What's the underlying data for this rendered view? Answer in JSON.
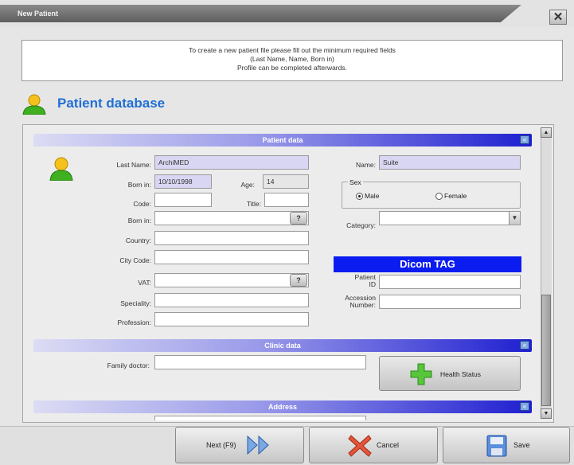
{
  "window": {
    "title": "New Patient",
    "close_glyph": "✕"
  },
  "info": {
    "line1": "To create a new patient file please fill out the minimum required fields",
    "line2": "(Last Name, Name, Born in)",
    "line3": "Profile can be completed afterwards."
  },
  "header": {
    "title": "Patient database"
  },
  "sections": {
    "patient_data": "Patient data",
    "clinic_data": "Clinic data",
    "address": "Address"
  },
  "patient": {
    "last_name_label": "Last Name:",
    "last_name": "ArchiMED",
    "name_label": "Name:",
    "name": "Suite",
    "born_in_date_label": "Born in:",
    "born_in_date": "10/10/1998",
    "age_label": "Age:",
    "age": "14",
    "code_label": "Code:",
    "code": "",
    "title_label": "Title:",
    "title": "",
    "born_in_place_label": "Born in:",
    "born_in_place": "",
    "country_label": "Country:",
    "country": "",
    "city_code_label": "City Code:",
    "city_code": "",
    "vat_label": "VAT:",
    "vat": "",
    "speciality_label": "Speciality:",
    "speciality": "",
    "profession_label": "Profession:",
    "profession": "",
    "help_glyph": "?",
    "sex_group_label": "Sex",
    "sex_male": "Male",
    "sex_female": "Female",
    "sex_selected": "Male",
    "category_label": "Category:",
    "category": ""
  },
  "dicom": {
    "title": "Dicom TAG",
    "patient_id_label_1": "Patient",
    "patient_id_label_2": "ID",
    "patient_id": "",
    "accession_label_1": "Accession",
    "accession_label_2": "Number:",
    "accession": ""
  },
  "clinic": {
    "family_doctor_label": "Family doctor:",
    "family_doctor": "",
    "health_status": "Health Status"
  },
  "buttons": {
    "next": "Next (F9)",
    "cancel": "Cancel",
    "save": "Save"
  },
  "colors": {
    "title_blue": "#1f6fd6",
    "dicom_blue": "#0b1cf0",
    "section_gradient_end": "#1f1fd0",
    "required_field": "#d8d6f3"
  }
}
